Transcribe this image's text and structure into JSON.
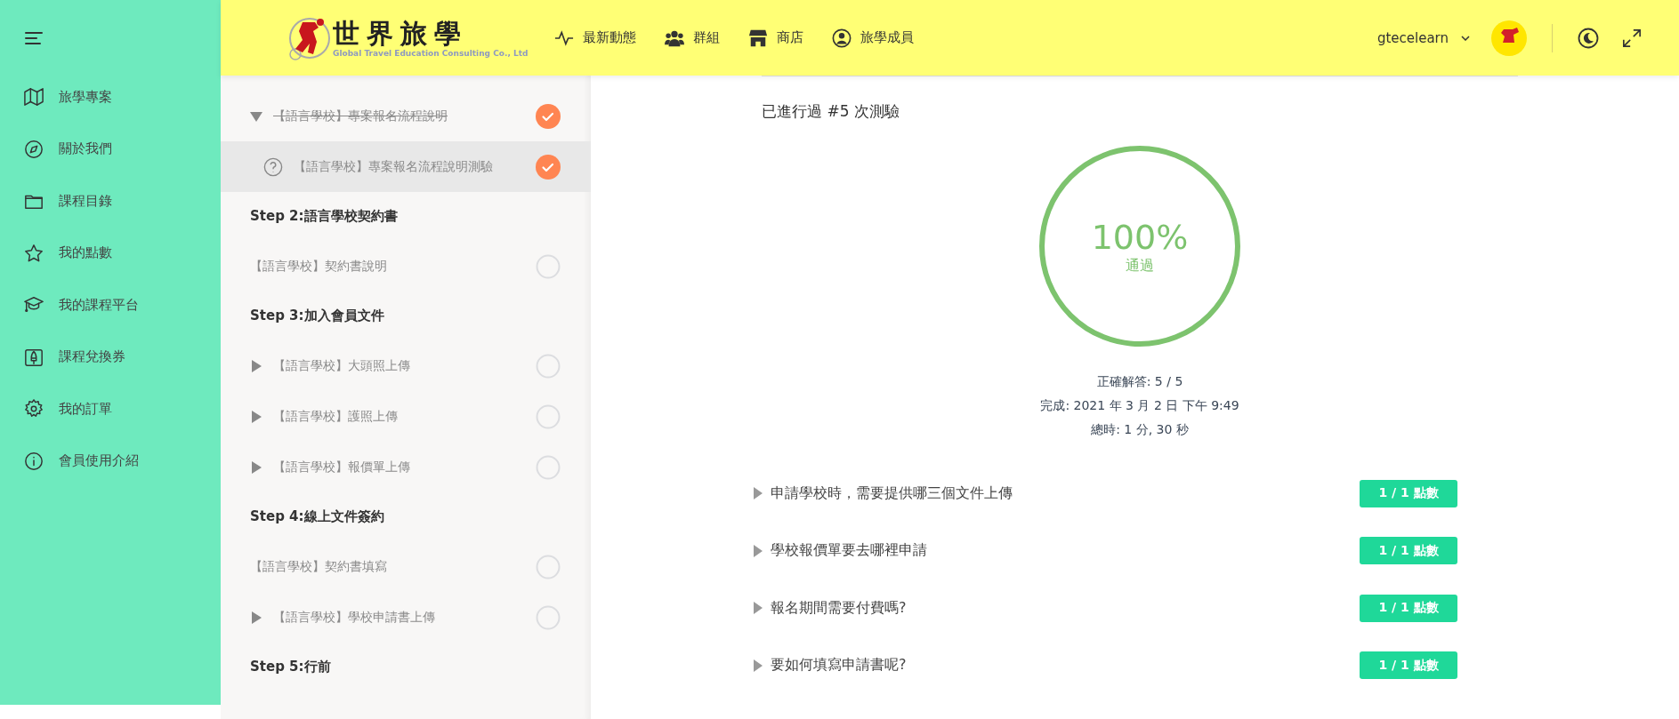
{
  "logo": {
    "title": "世界旅學",
    "subtitle": "Global Travel Education Consulting Co., Ltd"
  },
  "nav": [
    {
      "label": "最新動態"
    },
    {
      "label": "群組"
    },
    {
      "label": "商店"
    },
    {
      "label": "旅學成員"
    }
  ],
  "user": {
    "name": "gtecelearn"
  },
  "sidebar": {
    "items": [
      {
        "label": "旅學專案"
      },
      {
        "label": "關於我們"
      },
      {
        "label": "課程目錄"
      },
      {
        "label": "我的點數"
      },
      {
        "label": "我的課程平台"
      },
      {
        "label": "課程兌換券"
      },
      {
        "label": "我的訂單"
      },
      {
        "label": "會員使用介紹"
      }
    ]
  },
  "lessons": [
    {
      "kind": "lesson",
      "title": "【語言學校】專案報名流程說明",
      "expanded": true,
      "completed": true,
      "selected": false
    },
    {
      "kind": "quiz",
      "title": "【語言學校】專案報名流程說明測驗",
      "completed": true,
      "selected": true
    },
    {
      "kind": "section",
      "title": "Step 2:語言學校契約書"
    },
    {
      "kind": "plain",
      "title": "【語言學校】契約書說明",
      "completed": false,
      "selected": false
    },
    {
      "kind": "section",
      "title": "Step 3:加入會員文件"
    },
    {
      "kind": "lesson",
      "title": "【語言學校】大頭照上傳",
      "expanded": false,
      "completed": false,
      "selected": false
    },
    {
      "kind": "lesson",
      "title": "【語言學校】護照上傳",
      "expanded": false,
      "completed": false,
      "selected": false
    },
    {
      "kind": "lesson",
      "title": "【語言學校】報價單上傳",
      "expanded": false,
      "completed": false,
      "selected": false
    },
    {
      "kind": "section",
      "title": "Step 4:線上文件簽約"
    },
    {
      "kind": "plain",
      "title": "【語言學校】契約書填寫",
      "completed": false,
      "selected": false
    },
    {
      "kind": "lesson",
      "title": "【語言學校】學校申請書上傳",
      "expanded": false,
      "completed": false,
      "selected": false
    },
    {
      "kind": "section",
      "title": "Step 5:行前"
    }
  ],
  "quiz": {
    "attempts": "已進行過 #5 次測驗",
    "result": {
      "percent": "100%",
      "status": "通過",
      "level": 1
    },
    "stats": [
      "正確解答: 5 / 5",
      "完成: 2021 年 3 月 2 日 下午 9:49",
      "總時: 1 分, 30 秒"
    ],
    "questions": [
      {
        "text": "申請學校時，需要提供哪三個文件上傳",
        "score": "1 / 1 點數",
        "expanded": false
      },
      {
        "text": "學校報價單要去哪裡申請",
        "score": "1 / 1 點數",
        "expanded": false
      },
      {
        "text": "報名期間需要付費嗎?",
        "score": "1 / 1 點數",
        "expanded": false
      },
      {
        "text": "要如何填寫申請書呢?",
        "score": "1 / 1 點數",
        "expanded": false
      }
    ]
  }
}
